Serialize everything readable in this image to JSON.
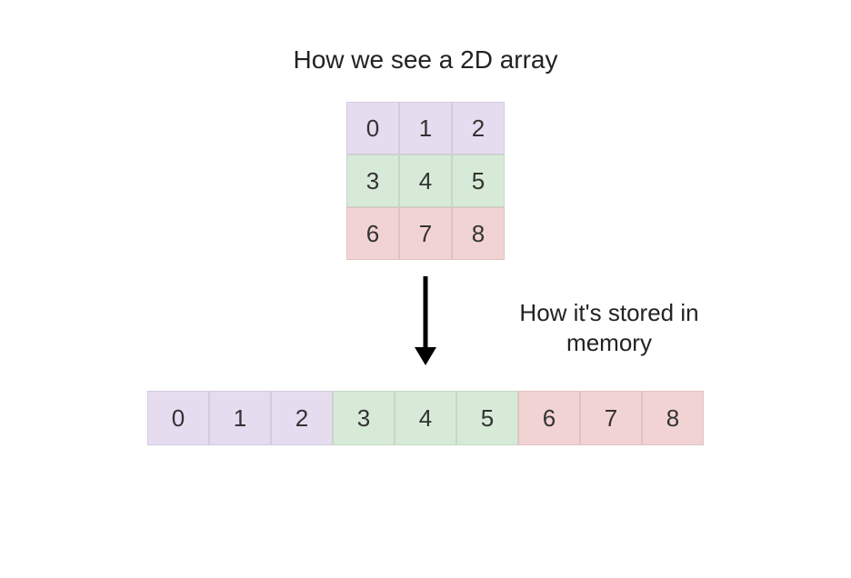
{
  "titles": {
    "top": "How we see a 2D array",
    "side_line1": "How it's stored in",
    "side_line2": "memory"
  },
  "grid_2d": {
    "rows": [
      {
        "color": "purple",
        "values": [
          "0",
          "1",
          "2"
        ]
      },
      {
        "color": "green",
        "values": [
          "3",
          "4",
          "5"
        ]
      },
      {
        "color": "pink",
        "values": [
          "6",
          "7",
          "8"
        ]
      }
    ]
  },
  "linear_memory": [
    {
      "value": "0",
      "color": "purple"
    },
    {
      "value": "1",
      "color": "purple"
    },
    {
      "value": "2",
      "color": "purple"
    },
    {
      "value": "3",
      "color": "green"
    },
    {
      "value": "4",
      "color": "green"
    },
    {
      "value": "5",
      "color": "green"
    },
    {
      "value": "6",
      "color": "pink"
    },
    {
      "value": "7",
      "color": "pink"
    },
    {
      "value": "8",
      "color": "pink"
    }
  ]
}
